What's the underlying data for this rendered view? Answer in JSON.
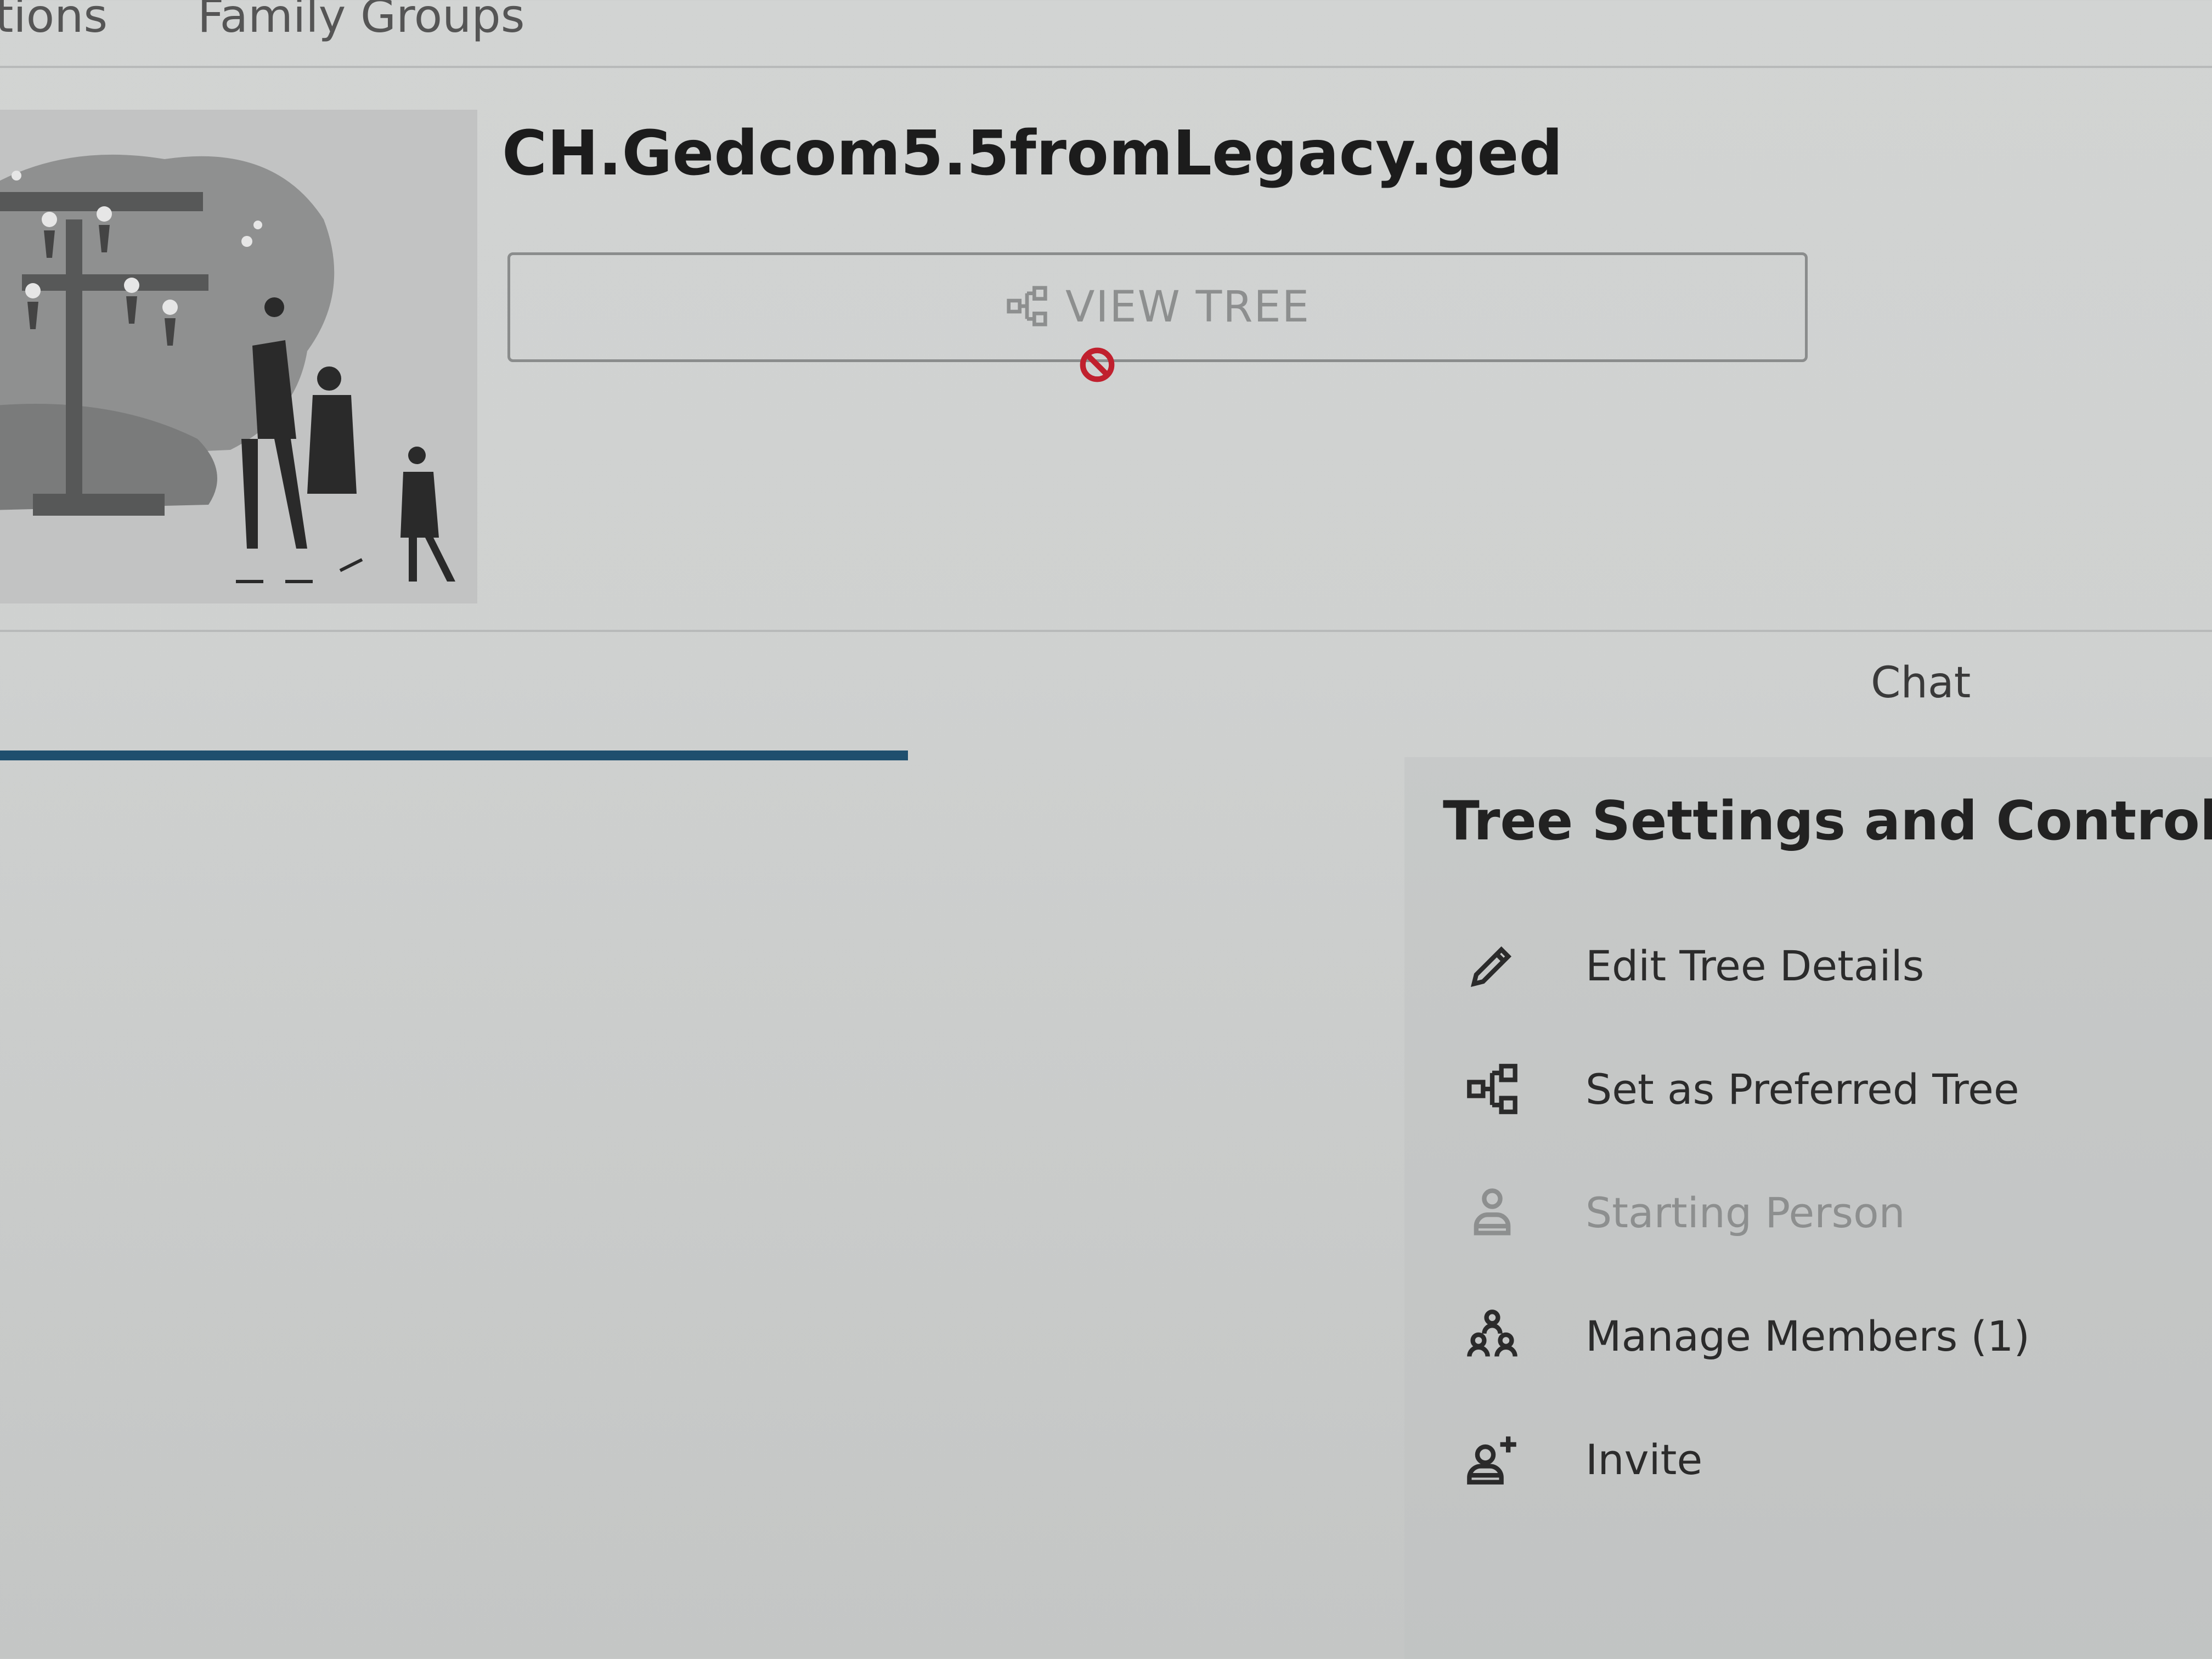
{
  "nav": {
    "item_a": "ations",
    "item_b": "Family Groups"
  },
  "tree": {
    "title": "CH.Gedcom5.5fromLegacy.ged",
    "view_button_label": "VIEW TREE"
  },
  "tabs": {
    "chat_label": "Chat"
  },
  "settings": {
    "title": "Tree Settings and Controls",
    "items": [
      {
        "label": "Edit Tree Details",
        "icon": "pencil-icon",
        "enabled": true
      },
      {
        "label": "Set as Preferred Tree",
        "icon": "tree-nodes-icon",
        "enabled": true
      },
      {
        "label": "Starting Person",
        "icon": "person-icon",
        "enabled": false
      },
      {
        "label": "Manage Members (1)",
        "icon": "group-icon",
        "enabled": true
      },
      {
        "label": "Invite",
        "icon": "person-add-icon",
        "enabled": true
      }
    ]
  },
  "colors": {
    "accent": "#1f4f6e",
    "disabled": "#8d8f8f",
    "cursor_block": "#c0202e"
  }
}
